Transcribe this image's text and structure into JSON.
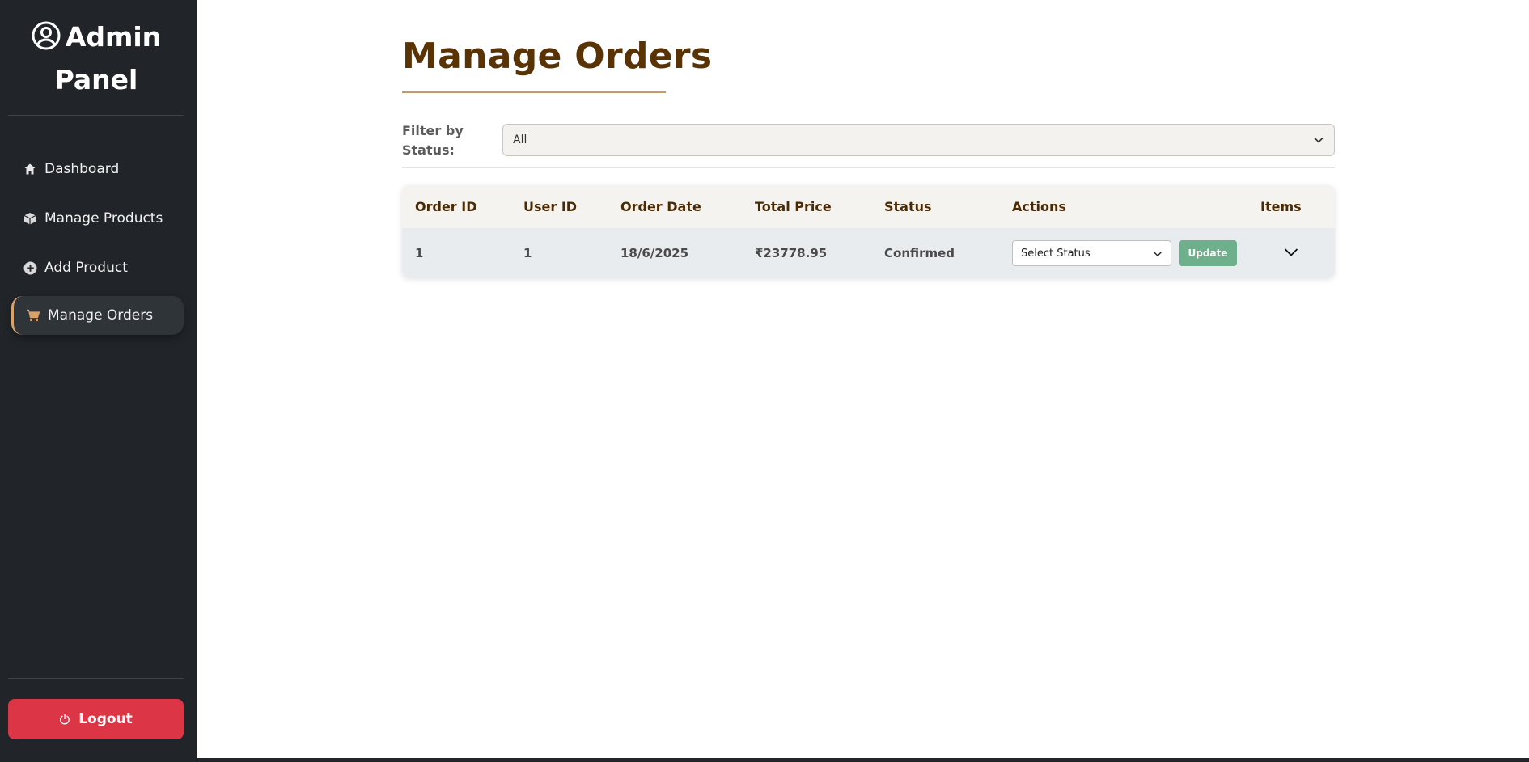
{
  "sidebar": {
    "brand_line1": "Admin",
    "brand_line2": "Panel",
    "brand_icon": "user-circle-icon",
    "items": [
      {
        "label": "Dashboard",
        "icon": "home-icon"
      },
      {
        "label": "Manage Products",
        "icon": "box-icon"
      },
      {
        "label": "Add Product",
        "icon": "plus-circle-icon"
      },
      {
        "label": "Manage Orders",
        "icon": "cart-icon",
        "active": true
      }
    ],
    "logout_label": "Logout",
    "logout_icon": "power-icon"
  },
  "main": {
    "title": "Manage Orders",
    "filter": {
      "label": "Filter by Status:",
      "value": "All"
    },
    "table": {
      "columns": [
        "Order ID",
        "User ID",
        "Order Date",
        "Total Price",
        "Status",
        "Actions",
        "Items"
      ],
      "rows": [
        {
          "order_id": "1",
          "user_id": "1",
          "order_date": "18/6/2025",
          "total_price": "₹23778.95",
          "status": "Confirmed",
          "select_placeholder": "Select Status",
          "update_label": "Update"
        }
      ]
    }
  },
  "colors": {
    "sidebar_bg": "#212529",
    "title": "#5a3305",
    "accent": "#c49a6c",
    "logout": "#dc3545",
    "update_button": "#6fb08c"
  }
}
